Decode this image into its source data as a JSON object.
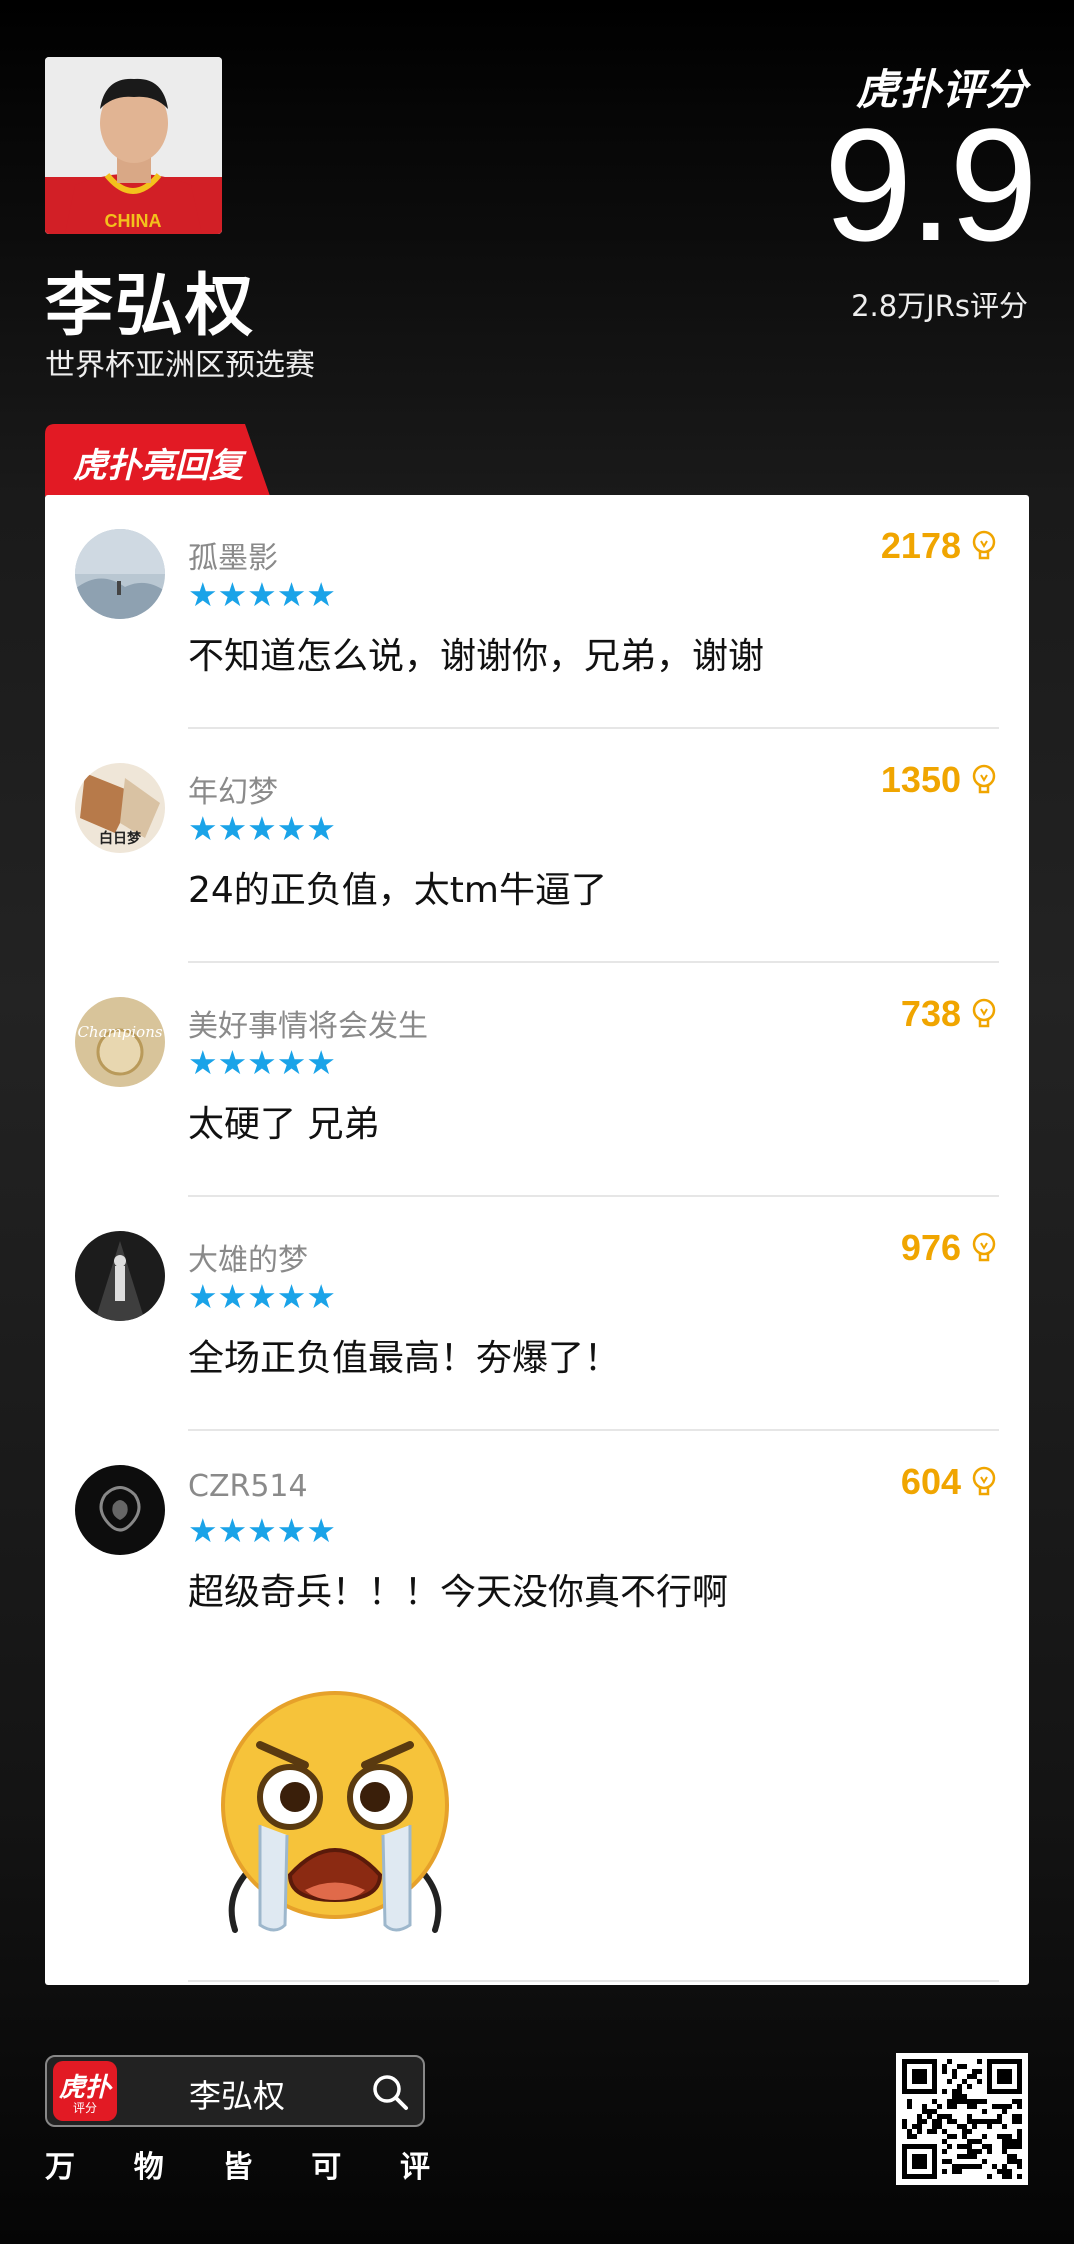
{
  "player": {
    "name": "李弘权",
    "event": "世界杯亚洲区预选赛",
    "jersey_text": "CHINA"
  },
  "rating": {
    "brand": "虎扑评分",
    "score": "9.9",
    "count": "2.8万JRs评分"
  },
  "highlight_tab": {
    "label": "虎扑亮回复"
  },
  "comments": [
    {
      "user": "孤墨影",
      "stars": "★★★★★",
      "likes": "2178",
      "text": "不知道怎么说，谢谢你，兄弟，谢谢"
    },
    {
      "user": "年幻梦",
      "stars": "★★★★★",
      "likes": "1350",
      "text": "24的正负值，太tm牛逼了",
      "avatar_text": "白日梦"
    },
    {
      "user": "美好事情将会发生",
      "stars": "★★★★★",
      "likes": "738",
      "text": "太硬了 兄弟",
      "avatar_text": "Champions"
    },
    {
      "user": "大雄的梦",
      "stars": "★★★★★",
      "likes": "976",
      "text": "全场正负值最高！夯爆了！"
    },
    {
      "user": "CZR514",
      "stars": "★★★★★",
      "likes": "604",
      "text": "超级奇兵！！！今天没你真不行啊"
    }
  ],
  "footer": {
    "app_icon_title": "虎扑",
    "app_icon_sub": "评分",
    "search_query": "李弘权",
    "slogan": [
      "万",
      "物",
      "皆",
      "可",
      "评"
    ]
  },
  "colors": {
    "accent_red": "#e21a24",
    "star_blue": "#1aa3e8",
    "likes_orange": "#f0a500"
  },
  "icons": [
    "search-icon",
    "lightbulb-icon",
    "crying-emoji",
    "qr-code"
  ]
}
